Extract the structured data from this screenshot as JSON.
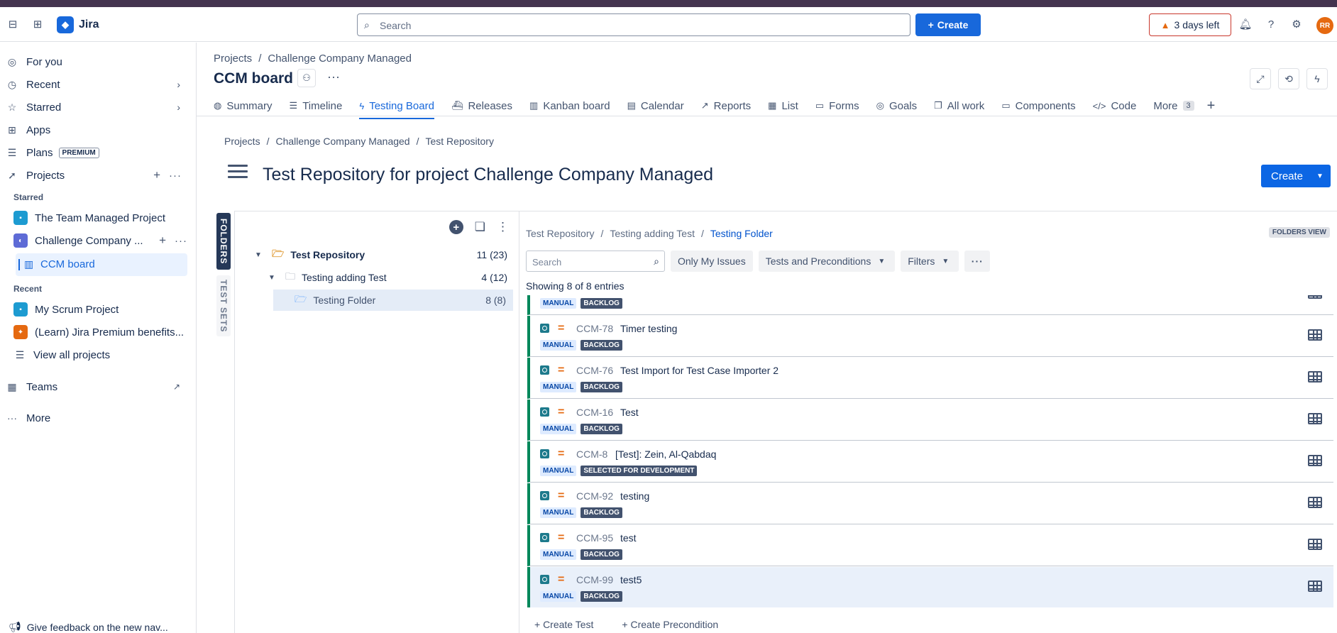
{
  "topnav": {
    "app_name": "Jira",
    "search_placeholder": "Search",
    "create_label": "Create",
    "trial_label": "3 days left",
    "avatar_initials": "RR"
  },
  "sidebar": {
    "for_you": "For you",
    "recent": "Recent",
    "starred": "Starred",
    "apps": "Apps",
    "plans": "Plans",
    "plans_badge": "PREMIUM",
    "projects": "Projects",
    "starred_section": "Starred",
    "starred_projects": [
      "The Team Managed Project",
      "Challenge Company ..."
    ],
    "board_item": "CCM board",
    "recent_section": "Recent",
    "recent_projects": [
      "My Scrum Project",
      "(Learn) Jira Premium benefits..."
    ],
    "view_all": "View all projects",
    "teams": "Teams",
    "more": "More",
    "feedback": "Give feedback on the new nav..."
  },
  "header": {
    "breadcrumb": [
      "Projects",
      "Challenge Company Managed"
    ],
    "board_title": "CCM board",
    "tabs": [
      {
        "label": "Summary",
        "icon": "globe-icon"
      },
      {
        "label": "Timeline",
        "icon": "timeline-icon"
      },
      {
        "label": "Testing Board",
        "icon": "bolt-icon"
      },
      {
        "label": "Releases",
        "icon": "ship-icon"
      },
      {
        "label": "Kanban board",
        "icon": "columns-icon"
      },
      {
        "label": "Calendar",
        "icon": "calendar-icon"
      },
      {
        "label": "Reports",
        "icon": "chart-icon"
      },
      {
        "label": "List",
        "icon": "table-icon"
      },
      {
        "label": "Forms",
        "icon": "form-icon"
      },
      {
        "label": "Goals",
        "icon": "target-icon"
      },
      {
        "label": "All work",
        "icon": "stack-icon"
      },
      {
        "label": "Components",
        "icon": "box-icon"
      },
      {
        "label": "Code",
        "icon": "code-icon"
      }
    ],
    "more_label": "More",
    "more_count": "3"
  },
  "xray": {
    "breadcrumb": [
      "Projects",
      "Challenge Company Managed",
      "Test Repository"
    ],
    "title": "Test Repository for project Challenge Company Managed",
    "create_label": "Create",
    "tab_folders": "FOLDERS",
    "tab_sets": "TEST SETS",
    "tree": [
      {
        "label": "Test Repository",
        "count": "11 (23)"
      },
      {
        "label": "Testing adding Test",
        "count": "4 (12)"
      },
      {
        "label": "Testing Folder",
        "count": "8 (8)"
      }
    ],
    "path": [
      "Test Repository",
      "Testing adding Test",
      "Testing Folder"
    ],
    "folders_view": "FOLDERS VIEW",
    "search_placeholder": "Search",
    "filter_only_mine": "Only My Issues",
    "filter_types": "Tests and Preconditions",
    "filter_filters": "Filters",
    "showing": "Showing 8 of 8 entries",
    "partial_row": {
      "type": "MANUAL",
      "status": "BACKLOG"
    },
    "rows": [
      {
        "key": "CCM-78",
        "summary": "Timer testing",
        "type": "MANUAL",
        "status": "BACKLOG"
      },
      {
        "key": "CCM-76",
        "summary": "Test Import for Test Case Importer 2",
        "type": "MANUAL",
        "status": "BACKLOG"
      },
      {
        "key": "CCM-16",
        "summary": "Test",
        "type": "MANUAL",
        "status": "BACKLOG"
      },
      {
        "key": "CCM-8",
        "summary": "[Test]: Zein, Al-Qabdaq",
        "type": "MANUAL",
        "status": "SELECTED FOR DEVELOPMENT"
      },
      {
        "key": "CCM-92",
        "summary": "testing",
        "type": "MANUAL",
        "status": "BACKLOG"
      },
      {
        "key": "CCM-95",
        "summary": "test",
        "type": "MANUAL",
        "status": "BACKLOG"
      },
      {
        "key": "CCM-99",
        "summary": "test5",
        "type": "MANUAL",
        "status": "BACKLOG"
      }
    ],
    "create_test": "+ Create Test",
    "create_precondition": "+ Create Precondition"
  }
}
